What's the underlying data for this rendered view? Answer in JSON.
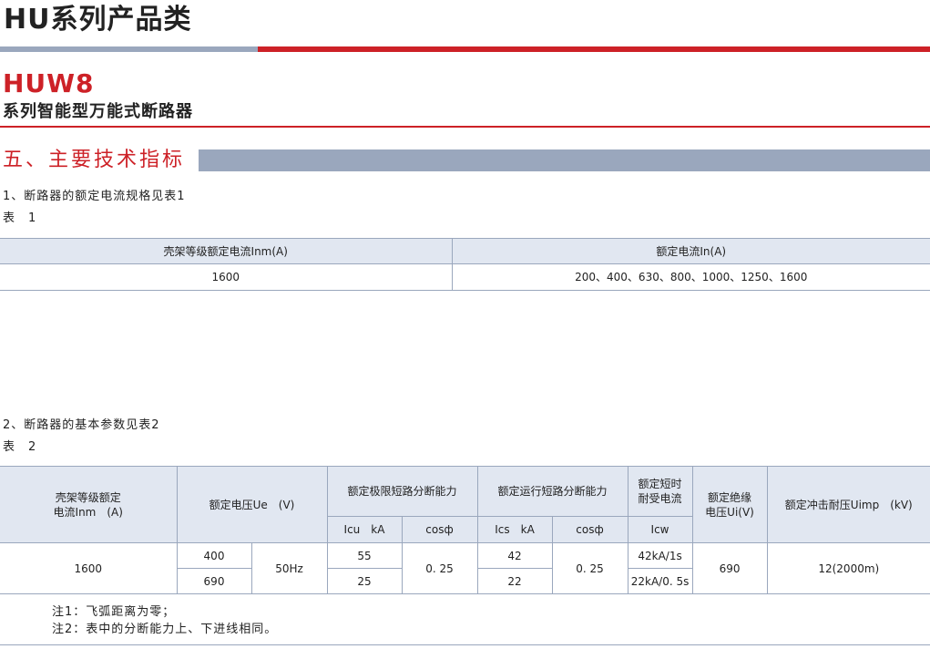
{
  "header": {
    "category": "HU系列产品类",
    "model": "HUW8",
    "series": "系列智能型万能式断路器"
  },
  "section": {
    "title": "五、主要技术指标"
  },
  "table1": {
    "intro": "1、断路器的额定电流规格见表1",
    "caption": "表　1",
    "headers": [
      "壳架等级额定电流Inm(A)",
      "额定电流In(A)"
    ],
    "row": [
      "1600",
      "200、400、630、800、1000、1250、1600"
    ]
  },
  "table2": {
    "intro": "2、断路器的基本参数见表2",
    "caption": "表　2",
    "headers": {
      "frame_current": "壳架等级额定\n电流Inm　(A)",
      "rated_voltage": "额定电压Ue　(V)",
      "icu_group": "额定极限短路分断能力",
      "ics_group": "额定运行短路分断能力",
      "icw_group": "额定短时\n耐受电流",
      "ui": "额定绝缘\n电压Ui(V)",
      "uimp": "额定冲击耐压Uimp　(kV)",
      "icu": "Icu　kA",
      "icu_cos": "cosф",
      "ics": "Ics　kA",
      "ics_cos": "cosф",
      "icw": "Icw"
    },
    "data": {
      "frame_current": "1600",
      "frequency": "50Hz",
      "icu_cos": "0. 25",
      "ics_cos": "0. 25",
      "ui": "690",
      "uimp": "12(2000m)",
      "rows": [
        {
          "voltage": "400",
          "icu": "55",
          "ics": "42",
          "icw": "42kA/1s"
        },
        {
          "voltage": "690",
          "icu": "25",
          "ics": "22",
          "icw": "22kA/0. 5s"
        }
      ]
    }
  },
  "notes": [
    "注1：飞弧距离为零；",
    "注2：表中的分断能力上、下进线相同。"
  ],
  "colors": {
    "accent_red": "#cd2127",
    "accent_gray": "#9aa7bd",
    "table_header_bg": "#e1e7f1"
  }
}
